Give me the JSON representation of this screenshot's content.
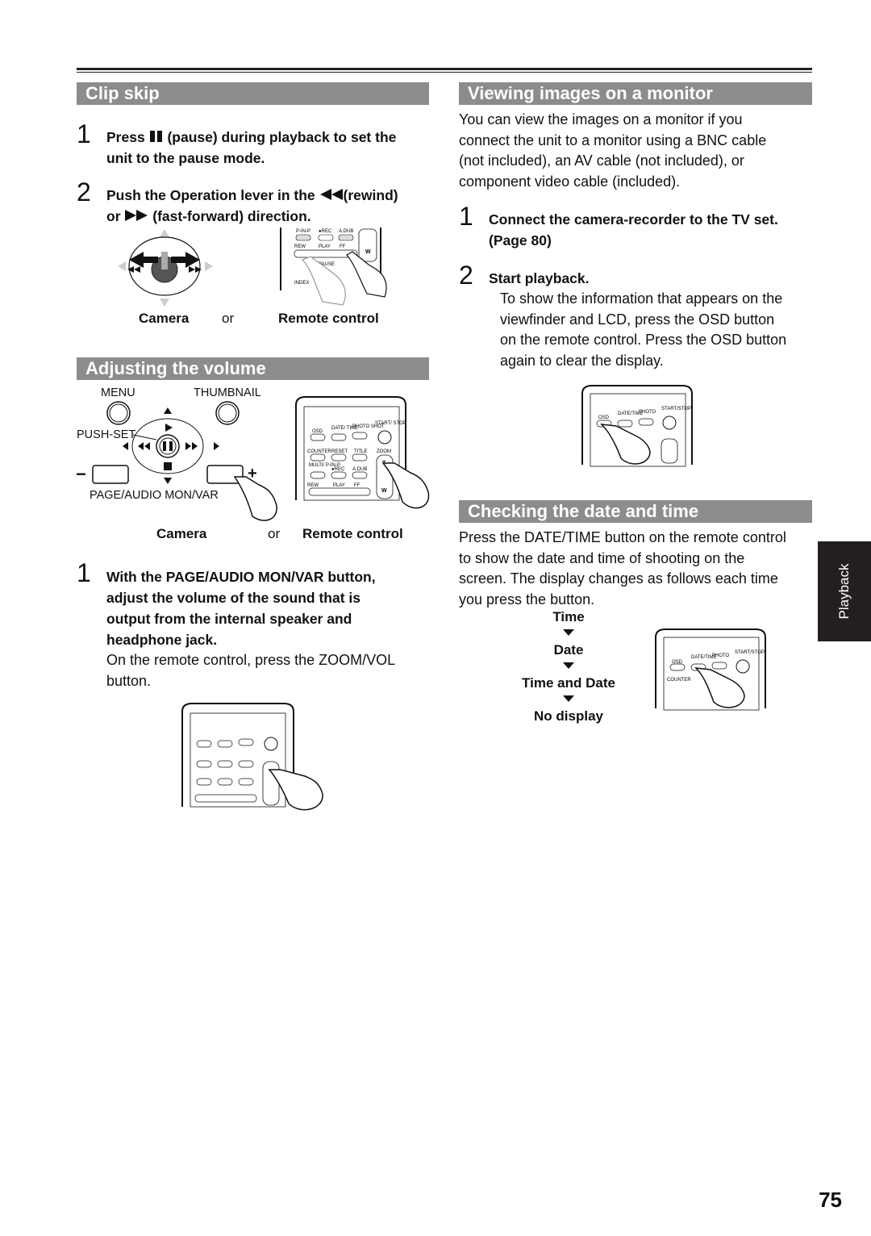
{
  "side_tab": "Playback",
  "page_number": "75",
  "clip_skip": {
    "title": "Clip skip",
    "steps": [
      {
        "num": "1",
        "text_before": "Press",
        "icon": "pause-icon",
        "text_after": "(pause) during playback to set the",
        "line2": "unit to the pause mode."
      },
      {
        "num": "2",
        "line1_before": "Push the Operation lever in the",
        "icon1": "rewind-icon",
        "line1_after": "(rewind)",
        "line2_before": "or",
        "icon2": "fast-forward-icon",
        "line2_after": "(fast-forward) direction."
      }
    ],
    "caption_camera": "Camera",
    "caption_or": "or",
    "caption_remote": "Remote control",
    "remote_labels": [
      "P-IN-P",
      "●REC",
      "A.DUB",
      "REW",
      "PLAY",
      "FF",
      "PAUSE",
      "INDEX",
      "W"
    ]
  },
  "adjust_volume": {
    "title": "Adjusting the volume",
    "camera_labels": {
      "menu": "MENU",
      "thumbnail": "THUMBNAIL",
      "push_set": "PUSH-SET",
      "page_audio": "PAGE/AUDIO MON/VAR",
      "minus": "−",
      "plus": "+"
    },
    "remote_labels": [
      "OSD",
      "DATE/ TIME",
      "PHOTO SHOT",
      "START/ STOP",
      "COUNTER",
      "RESET",
      "TITLE",
      "ZOOM",
      "MULTI/ P-IN-P",
      "●REC",
      "A.DUB",
      "REW",
      "PLAY",
      "FF",
      "T",
      "W"
    ],
    "caption_camera": "Camera",
    "caption_or": "or",
    "caption_remote": "Remote control",
    "step": {
      "num": "1",
      "lines": [
        "With the PAGE/AUDIO MON/VAR button,",
        "adjust the volume of the sound that is",
        "output from the internal speaker and",
        "headphone jack."
      ]
    },
    "note": [
      "On the remote control, press the ZOOM/VOL",
      "button."
    ]
  },
  "viewing_monitor": {
    "title": "Viewing images on a monitor",
    "intro": [
      "You can view the images on a monitor if you",
      "connect the unit to a monitor using a BNC cable",
      "(not included), an AV cable (not included), or",
      "component video cable (included)."
    ],
    "steps": [
      {
        "num": "1",
        "lines": [
          "Connect the camera-recorder to the TV set.",
          "(Page 80)"
        ]
      },
      {
        "num": "2",
        "lines": [
          "Start playback."
        ],
        "body": [
          "To show the information that appears on the",
          "viewfinder and LCD, press the OSD button",
          "on the remote control. Press the OSD button",
          "again to clear the display."
        ]
      }
    ]
  },
  "date_time": {
    "title": "Checking the date and time",
    "intro": [
      "Press the DATE/TIME button on the remote control",
      "to show the date and time of shooting on the",
      "screen. The display changes as follows each time",
      "you press the button."
    ],
    "flow": [
      "Time",
      "Date",
      "Time and Date",
      "No display"
    ]
  }
}
